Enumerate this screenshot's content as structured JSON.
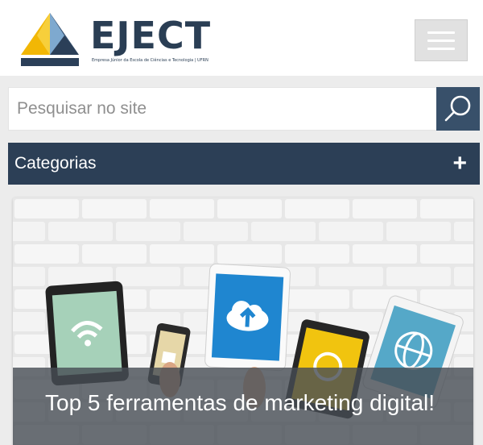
{
  "brand": {
    "name": "EJECT",
    "tagline": "Empresa Júnior da Escola de Ciências e Tecnologia | UFRN"
  },
  "header": {
    "menu_icon": "hamburger-menu-icon"
  },
  "search": {
    "placeholder": "Pesquisar no site",
    "value": "",
    "icon": "search-icon"
  },
  "categories": {
    "label": "Categorias",
    "icon": "+"
  },
  "featured_post": {
    "title": "Top 5 ferramentas de marketing digital!"
  },
  "colors": {
    "navy": "#2c3f56",
    "search_button": "#38506a",
    "menu_button": "#e1e1e1",
    "page_background": "#ececec"
  }
}
